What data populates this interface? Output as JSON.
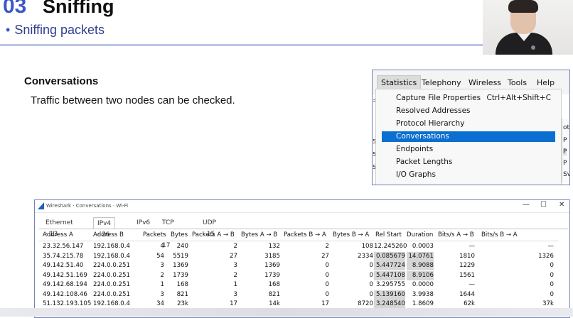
{
  "slide": {
    "section_number": "03",
    "section_title": "Sniffing",
    "subtitle": "Sniffing packets",
    "heading": "Conversations",
    "description": "Traffic between two nodes can be checked."
  },
  "menu": {
    "bar": [
      "Statistics",
      "Telephony",
      "Wireless",
      "Tools",
      "Help"
    ],
    "active": "Statistics",
    "items": [
      {
        "label": "Capture File Properties",
        "shortcut": "Ctrl+Alt+Shift+C"
      },
      {
        "label": "Resolved Addresses",
        "shortcut": ""
      },
      {
        "label": "Protocol Hierarchy",
        "shortcut": ""
      },
      {
        "label": "Conversations",
        "shortcut": ""
      },
      {
        "label": "Endpoints",
        "shortcut": ""
      },
      {
        "label": "Packet Lengths",
        "shortcut": ""
      },
      {
        "label": "I/O Graphs",
        "shortcut": ""
      }
    ],
    "selected": "Conversations",
    "right_strip": [
      "oto",
      "P",
      "P",
      "P",
      "Sv"
    ],
    "left_strip": [
      ">",
      "5",
      "5",
      "5"
    ]
  },
  "window": {
    "title": "Wireshark · Conversations · Wi-Fi",
    "controls": [
      "—",
      "☐",
      "✕"
    ],
    "tabs": [
      "Ethernet · 13",
      "IPv4 · 26",
      "IPv6",
      "TCP · 17",
      "UDP · 15"
    ],
    "active_tab": "IPv4 · 26",
    "columns": [
      "Address A",
      "Address B",
      "Packets",
      "Bytes",
      "Packets A → B",
      "Bytes A → B",
      "Packets B → A",
      "Bytes B → A",
      "Rel Start",
      "Duration",
      "Bits/s A → B",
      "Bits/s B → A"
    ],
    "rows": [
      [
        "23.32.56.147",
        "192.168.0.4",
        "4",
        "240",
        "2",
        "132",
        "2",
        "108",
        "12.245260",
        "0.0003",
        "—",
        "—"
      ],
      [
        "35.74.215.78",
        "192.168.0.4",
        "54",
        "5519",
        "27",
        "3185",
        "27",
        "2334",
        "0.085679",
        "14.0761",
        "1810",
        "1326"
      ],
      [
        "49.142.51.40",
        "224.0.0.251",
        "3",
        "1369",
        "3",
        "1369",
        "0",
        "0",
        "5.447724",
        "8.9088",
        "1229",
        "0"
      ],
      [
        "49.142.51.169",
        "224.0.0.251",
        "2",
        "1739",
        "2",
        "1739",
        "0",
        "0",
        "5.447108",
        "8.9106",
        "1561",
        "0"
      ],
      [
        "49.142.68.194",
        "224.0.0.251",
        "1",
        "168",
        "1",
        "168",
        "0",
        "0",
        "3.295755",
        "0.0000",
        "—",
        "0"
      ],
      [
        "49.142.108.46",
        "224.0.0.251",
        "3",
        "821",
        "3",
        "821",
        "0",
        "0",
        "5.139160",
        "3.9938",
        "1644",
        "0"
      ],
      [
        "51.132.193.105",
        "192.168.0.4",
        "34",
        "23k",
        "17",
        "14k",
        "17",
        "8720",
        "3.248540",
        "1.8609",
        "62k",
        "37k"
      ]
    ]
  }
}
